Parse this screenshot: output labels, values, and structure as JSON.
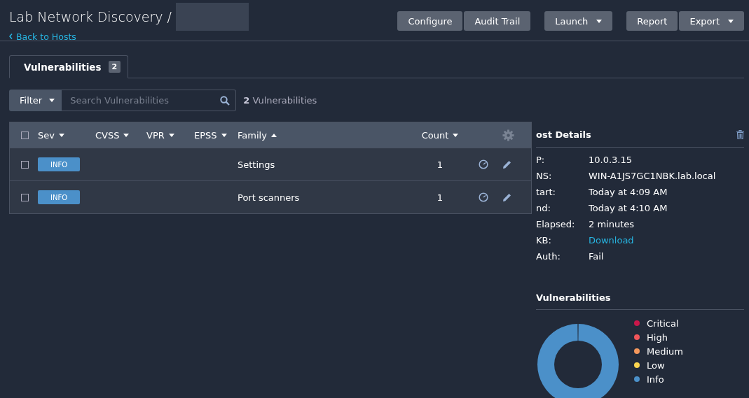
{
  "header": {
    "title": "Lab Network Discovery /",
    "back_link": "Back to Hosts",
    "button_groups": [
      {
        "buttons": [
          {
            "label": "Configure",
            "dropdown": false
          },
          {
            "label": "Audit Trail",
            "dropdown": false
          }
        ]
      },
      {
        "buttons": [
          {
            "label": "Launch",
            "dropdown": true
          }
        ]
      },
      {
        "buttons": [
          {
            "label": "Report",
            "dropdown": false
          },
          {
            "label": "Export",
            "dropdown": true
          }
        ]
      }
    ]
  },
  "tabs": [
    {
      "label": "Vulnerabilities",
      "count": "2",
      "selected": true
    }
  ],
  "filter": {
    "button": "Filter",
    "placeholder": "Search Vulnerabilities",
    "result_count": "2",
    "result_label": "Vulnerabilities"
  },
  "table": {
    "select_all_checked": false,
    "columns": [
      {
        "label": "Sev",
        "ascending": false
      },
      {
        "label": "CVSS",
        "ascending": false
      },
      {
        "label": "VPR",
        "ascending": false
      },
      {
        "label": "EPSS",
        "ascending": false
      },
      {
        "label": "Family",
        "ascending": true
      },
      {
        "label": "Count",
        "ascending": false
      }
    ],
    "rows": [
      {
        "checked": false,
        "severity": "INFO",
        "family": "Settings",
        "count": "1"
      },
      {
        "checked": false,
        "severity": "INFO",
        "family": "Port scanners",
        "count": "1"
      }
    ]
  },
  "host_details": {
    "title": "ost Details",
    "fields": [
      {
        "label": "P:",
        "value": "10.0.3.15",
        "kind": "text"
      },
      {
        "label": "NS:",
        "value": "WIN-A1JS7GC1NBK.lab.local",
        "kind": "text"
      },
      {
        "label": "tart:",
        "value": "Today at 4:09 AM",
        "kind": "text"
      },
      {
        "label": "nd:",
        "value": "Today at 4:10 AM",
        "kind": "text"
      },
      {
        "label": "Elapsed:",
        "value": "2 minutes",
        "kind": "text"
      },
      {
        "label": "KB:",
        "value": "Download",
        "kind": "link"
      },
      {
        "label": "Auth:",
        "value": "Fail",
        "kind": "text"
      }
    ]
  },
  "vulnerabilities_chart": {
    "title": "Vulnerabilities",
    "chart_data": {
      "type": "donut",
      "categories": [
        "Critical",
        "High",
        "Medium",
        "Low",
        "Info"
      ],
      "values": [
        0,
        0,
        0,
        0,
        100
      ],
      "colors": [
        "#c8174a",
        "#f0555a",
        "#f4975c",
        "#fbd44f",
        "#4b90c9"
      ]
    }
  }
}
